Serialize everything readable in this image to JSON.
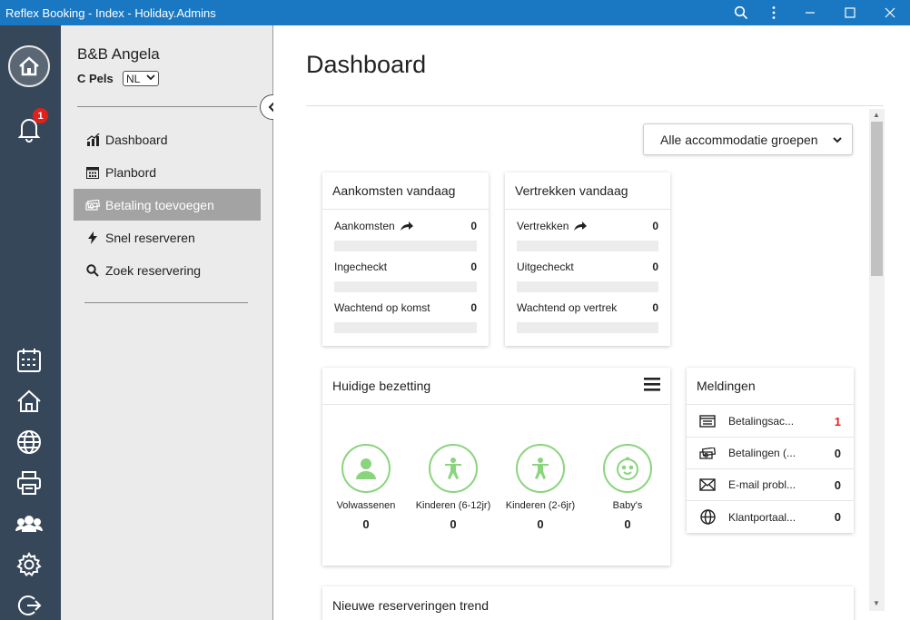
{
  "window": {
    "title": "Reflex Booking - Index - Holiday.Admins"
  },
  "rail": {
    "notifications_badge": "1"
  },
  "menu": {
    "business_name": "B&B Angela",
    "user_name": "C Pels",
    "language": "NL",
    "items": [
      {
        "label": "Dashboard",
        "icon": "chart-icon"
      },
      {
        "label": "Planbord",
        "icon": "calendar-grid-icon"
      },
      {
        "label": "Betaling toevoegen",
        "icon": "money-icon",
        "active": true
      },
      {
        "label": "Snel reserveren",
        "icon": "lightning-icon"
      },
      {
        "label": "Zoek reservering",
        "icon": "search-icon"
      }
    ]
  },
  "main": {
    "title": "Dashboard",
    "group_select": "Alle accommodatie groepen",
    "arrivals": {
      "title": "Aankomsten vandaag",
      "rows": [
        {
          "label": "Aankomsten",
          "value": "0"
        },
        {
          "label": "Ingecheckt",
          "value": "0"
        },
        {
          "label": "Wachtend op komst",
          "value": "0"
        }
      ]
    },
    "departures": {
      "title": "Vertrekken vandaag",
      "rows": [
        {
          "label": "Vertrekken",
          "value": "0"
        },
        {
          "label": "Uitgecheckt",
          "value": "0"
        },
        {
          "label": "Wachtend op vertrek",
          "value": "0"
        }
      ]
    },
    "occupancy": {
      "title": "Huidige bezetting",
      "items": [
        {
          "label": "Volwassenen",
          "value": "0"
        },
        {
          "label": "Kinderen (6-12jr)",
          "value": "0"
        },
        {
          "label": "Kinderen (2-6jr)",
          "value": "0"
        },
        {
          "label": "Baby's",
          "value": "0"
        }
      ]
    },
    "notifications": {
      "title": "Meldingen",
      "items": [
        {
          "label": "Betalingsac...",
          "value": "1",
          "color": "#e0201b"
        },
        {
          "label": "Betalingen (...",
          "value": "0"
        },
        {
          "label": "E-mail probl...",
          "value": "0"
        },
        {
          "label": "Klantportaal...",
          "value": "0"
        }
      ]
    },
    "trend": {
      "title": "Nieuwe reserveringen trend"
    }
  },
  "colors": {
    "titlebar": "#1a78c2",
    "rail": "#37475a",
    "accent_green": "#8bd47e",
    "badge": "#e0201b"
  }
}
